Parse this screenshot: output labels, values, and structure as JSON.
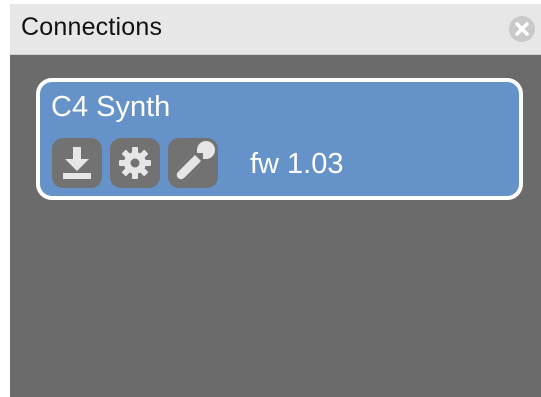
{
  "panel": {
    "title": "Connections",
    "close_icon": "close-circle-icon"
  },
  "device": {
    "name": "C4 Synth",
    "firmware": "fw 1.03",
    "actions": [
      {
        "name": "download",
        "icon": "download-icon"
      },
      {
        "name": "settings",
        "icon": "gear-icon"
      },
      {
        "name": "tools",
        "icon": "wrench-icon"
      }
    ]
  },
  "colors": {
    "panel_background": "#6b6b6b",
    "header_background": "#e7e7e7",
    "card_background": "#6592c8",
    "card_border": "#ffffff",
    "button_background": "#727272",
    "icon_color": "#e6e6e6"
  }
}
